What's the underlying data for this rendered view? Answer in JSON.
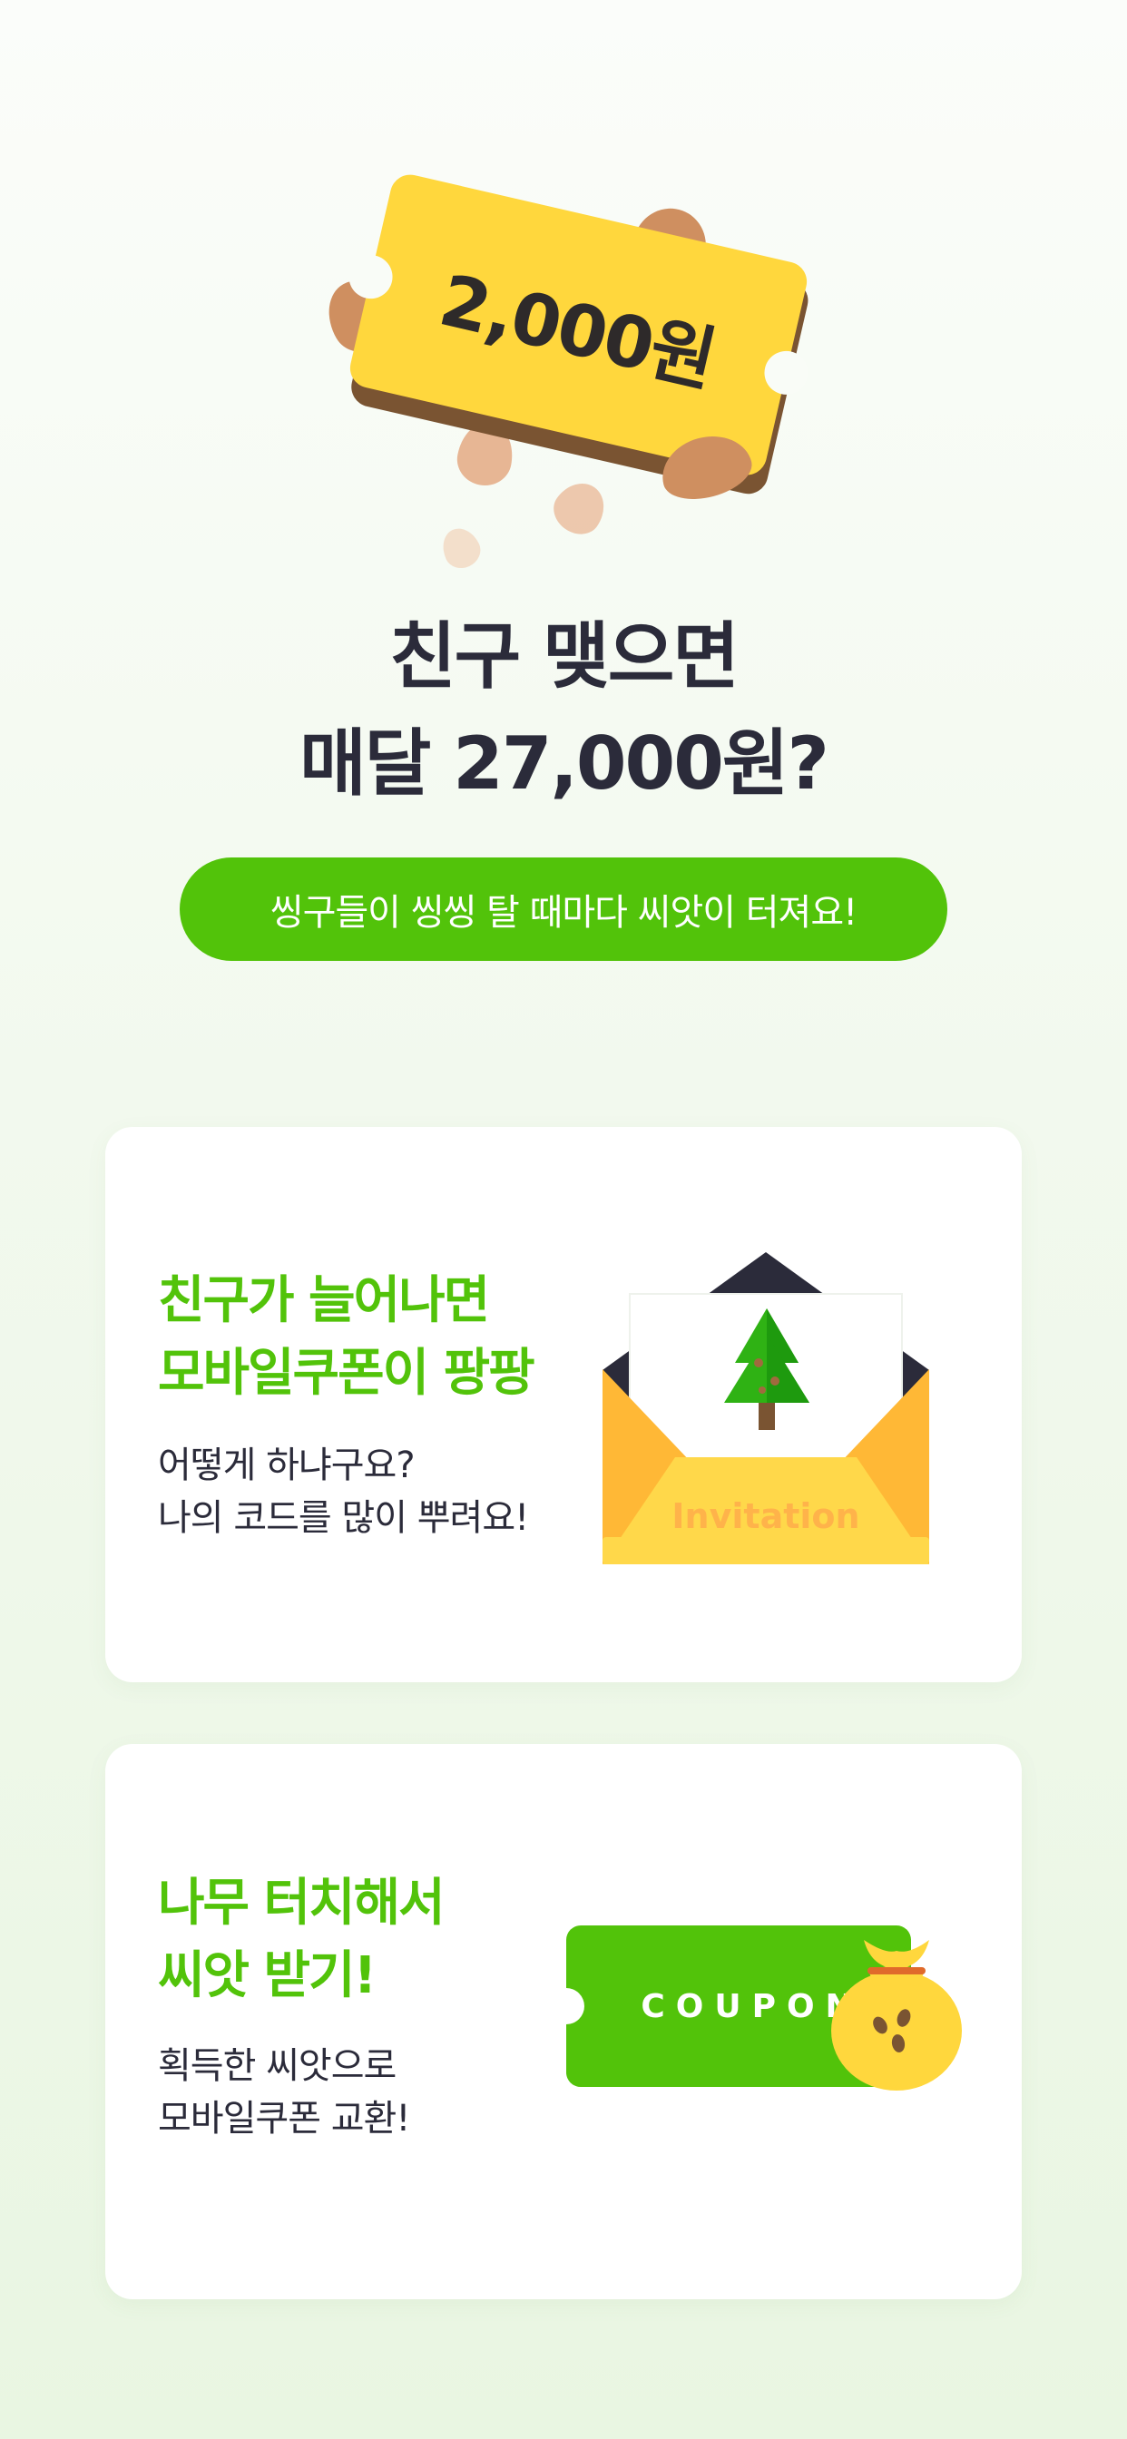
{
  "hero": {
    "ticket_amount": "2,000원",
    "headline_line1": "친구 맺으면",
    "headline_line2": "매달 27,000원?",
    "pill_text": "씽구들이 씽씽 탈 때마다 씨앗이 터져요!"
  },
  "cards": [
    {
      "title_line1": "친구가 늘어나면",
      "title_line2": "모바일쿠폰이 팡팡",
      "desc_line1": "어떻게 하냐구요?",
      "desc_line2": "나의 코드를 많이 뿌려요!",
      "illustration_label": "Invitation"
    },
    {
      "title_line1": "나무 터치해서",
      "title_line2": "씨앗 받기!",
      "desc_line1": "획득한 씨앗으로",
      "desc_line2": "모바일쿠폰 교환!",
      "illustration_label": "COUPON"
    }
  ],
  "colors": {
    "accent_green": "#52c30a",
    "ticket_yellow": "#ffd73d",
    "seed_brown": "#cf8f60",
    "text_dark": "#2b2b3a"
  },
  "icons": [
    "seed-icon",
    "coupon-ticket-icon",
    "envelope-icon",
    "tree-icon",
    "money-bag-icon"
  ]
}
